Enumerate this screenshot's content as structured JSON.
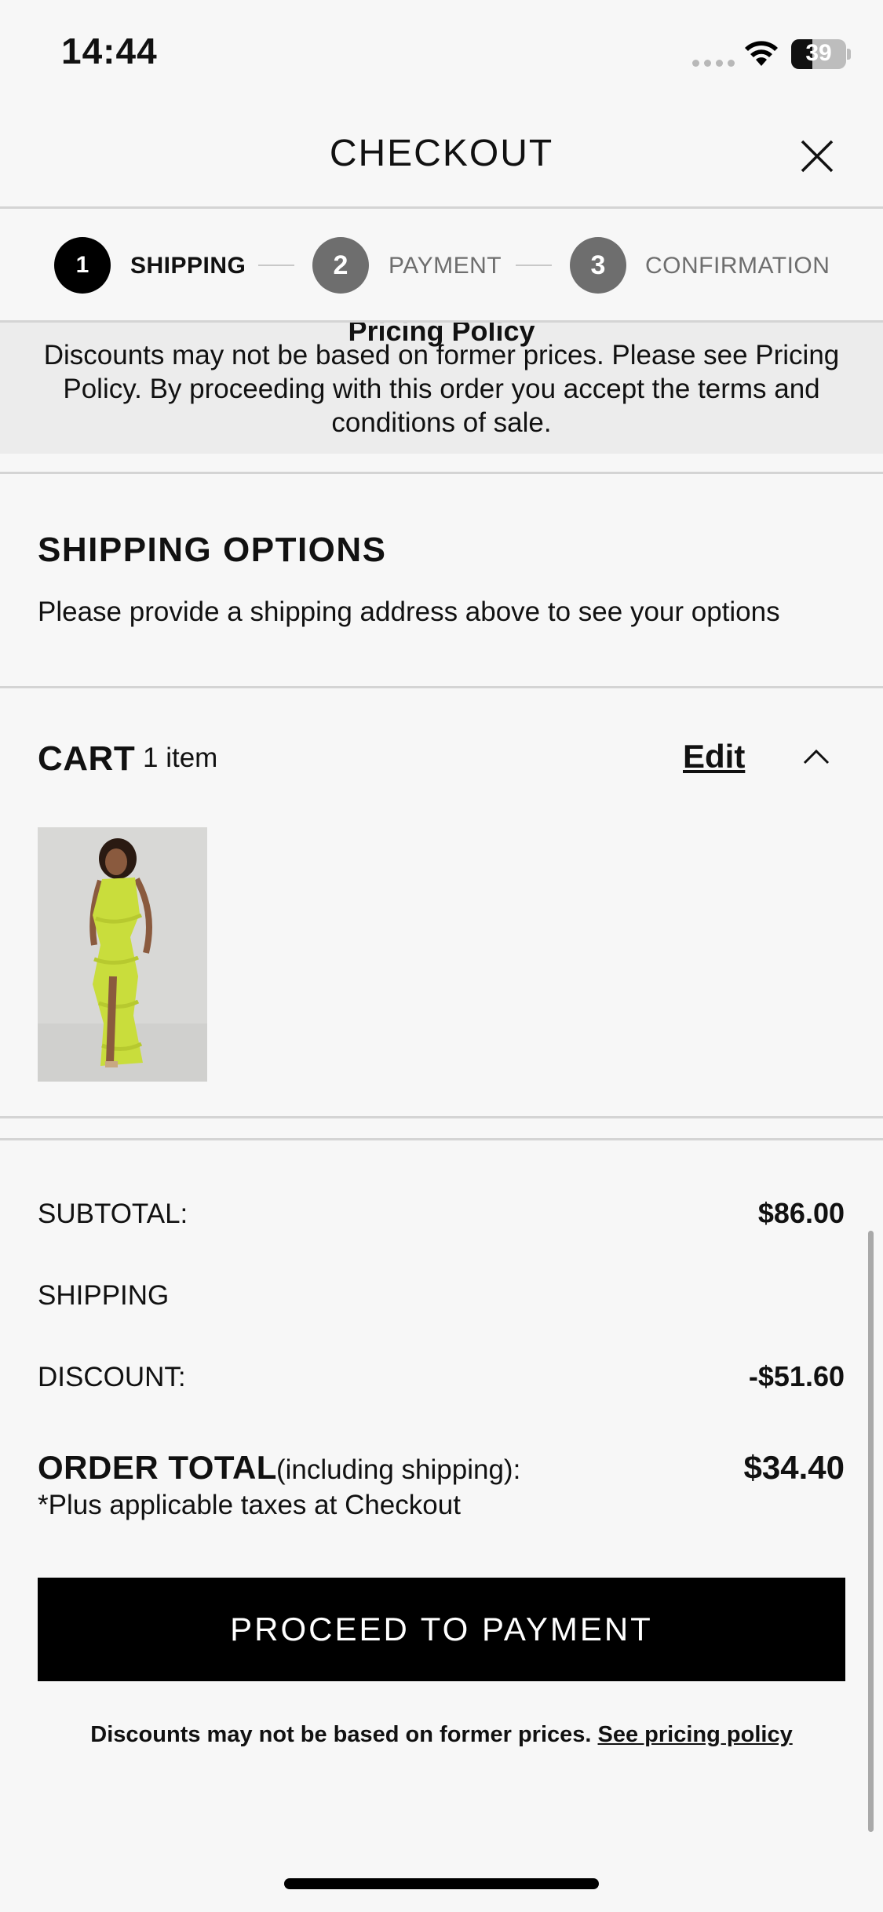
{
  "status_bar": {
    "time": "14:44",
    "battery": "39"
  },
  "header": {
    "title": "CHECKOUT",
    "close_icon": "close-icon"
  },
  "stepper": {
    "steps": [
      {
        "number": "1",
        "label": "SHIPPING",
        "state": "active"
      },
      {
        "number": "2",
        "label": "PAYMENT",
        "state": "inactive"
      },
      {
        "number": "3",
        "label": "CONFIRMATION",
        "state": "inactive"
      }
    ]
  },
  "notice": {
    "title": "Pricing Policy",
    "text": "Discounts may not be based on former prices. Please see Pricing Policy. By proceeding with this order you accept the terms and conditions of sale."
  },
  "shipping_options": {
    "title": "SHIPPING OPTIONS",
    "message": "Please provide a shipping address above to see your options"
  },
  "cart": {
    "title": "CART",
    "count": "1 item",
    "edit_label": "Edit",
    "collapse_icon": "chevron-up-icon",
    "product_colors": {
      "dress": "#c9dd3c",
      "background": "#d6d6d4",
      "skin": "#8a5a3e",
      "hair": "#2a1a12"
    }
  },
  "summary": {
    "subtotal_label": "SUBTOTAL:",
    "subtotal_value": "$86.00",
    "shipping_label": "SHIPPING",
    "discount_label": "DISCOUNT:",
    "discount_value": "-$51.60",
    "total_label": "ORDER TOTAL",
    "total_qualifier": "(including shipping):",
    "total_value": "$34.40",
    "tax_note": "*Plus applicable taxes at Checkout"
  },
  "cta": {
    "label": "PROCEED TO PAYMENT"
  },
  "footnote": {
    "text": "Discounts may not be based on former prices.",
    "link": "See pricing policy"
  }
}
